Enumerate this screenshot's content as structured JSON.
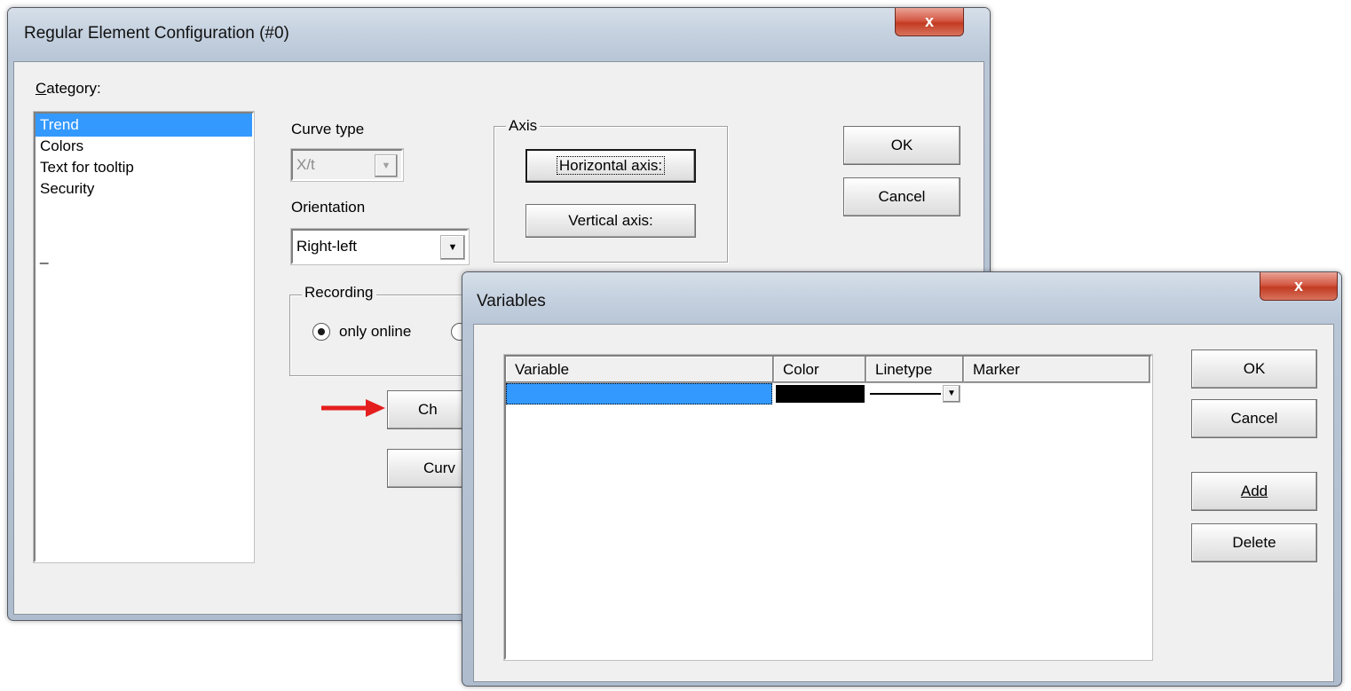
{
  "regular_dialog": {
    "title": "Regular Element Configuration (#0)",
    "close_label": "x",
    "category_label": "Category:",
    "categories": [
      "Trend",
      "Colors",
      "Text for tooltip",
      "Security"
    ],
    "underscore_item": "_",
    "curve_type_label": "Curve type",
    "curve_type_value": "X/t",
    "orientation_label": "Orientation",
    "orientation_value": "Right-left",
    "axis_group_title": "Axis",
    "horizontal_axis_button": "Horizontal axis:",
    "vertical_axis_button": "Vertical axis:",
    "recording_group_title": "Recording",
    "recording_option_online": "only online",
    "choose_button_partial": "Ch",
    "curves_button_partial": "Curv",
    "ok_button": "OK",
    "cancel_button": "Cancel"
  },
  "variables_dialog": {
    "title": "Variables",
    "close_label": "x",
    "columns": [
      "Variable",
      "Color",
      "Linetype",
      "Marker"
    ],
    "rows": [
      {
        "variable": "",
        "color": "#000000",
        "linetype": "solid",
        "marker": ""
      }
    ],
    "ok_button": "OK",
    "cancel_button": "Cancel",
    "add_button": "Add",
    "delete_button": "Delete"
  },
  "annotation": {
    "arrow_color": "#e41e1e"
  },
  "colors": {
    "selection": "#3399ff",
    "close_button": "#c9432b"
  }
}
